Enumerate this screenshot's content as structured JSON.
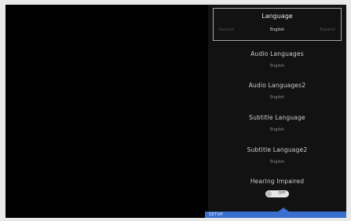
{
  "language": {
    "title": "Language",
    "previous": "Deutsch",
    "current": "English",
    "next": "Español"
  },
  "settings": [
    {
      "label": "Audio Languages",
      "value": "English"
    },
    {
      "label": "Audio Languages2",
      "value": "English"
    },
    {
      "label": "Subtitle Language",
      "value": "English"
    },
    {
      "label": "Subtitle Language2",
      "value": "English"
    }
  ],
  "hearing_impaired": {
    "label": "Hearing Impaired",
    "state": "OFF"
  },
  "footer": {
    "menu_label": "SETUP",
    "accent_color": "#3b6fcf"
  }
}
